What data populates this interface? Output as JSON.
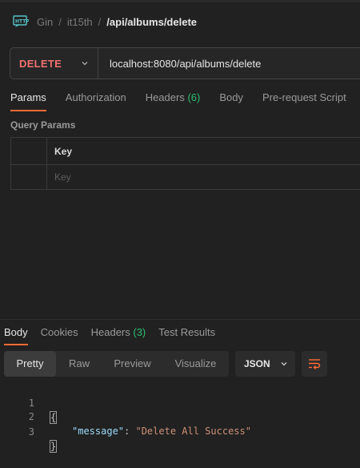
{
  "breadcrumb": {
    "workspace": "Gin",
    "collection": "it15th",
    "request": "/api/albums/delete",
    "separator": "/"
  },
  "request": {
    "method": "DELETE",
    "url": "localhost:8080/api/albums/delete"
  },
  "request_tabs": [
    {
      "label": "Params",
      "active": true
    },
    {
      "label": "Authorization"
    },
    {
      "label": "Headers",
      "count": "(6)"
    },
    {
      "label": "Body"
    },
    {
      "label": "Pre-request Script"
    }
  ],
  "query_params": {
    "title": "Query Params",
    "column_key": "Key",
    "key_placeholder": "Key"
  },
  "response_tabs": [
    {
      "label": "Body",
      "active": true
    },
    {
      "label": "Cookies"
    },
    {
      "label": "Headers",
      "count": "(3)"
    },
    {
      "label": "Test Results"
    }
  ],
  "view_modes": [
    "Pretty",
    "Raw",
    "Preview",
    "Visualize"
  ],
  "format": "JSON",
  "code": {
    "line_numbers": [
      "1",
      "2",
      "3"
    ],
    "open_brace": "{",
    "key": "\"message\"",
    "colon": ": ",
    "value": "\"Delete All Success\"",
    "close_brace": "}"
  },
  "colors": {
    "accent": "#ff6c37",
    "method": "#f0716e",
    "count": "#2fbf71"
  },
  "icons": [
    "http-icon",
    "chevron-down-icon",
    "wrap-lines-icon"
  ]
}
